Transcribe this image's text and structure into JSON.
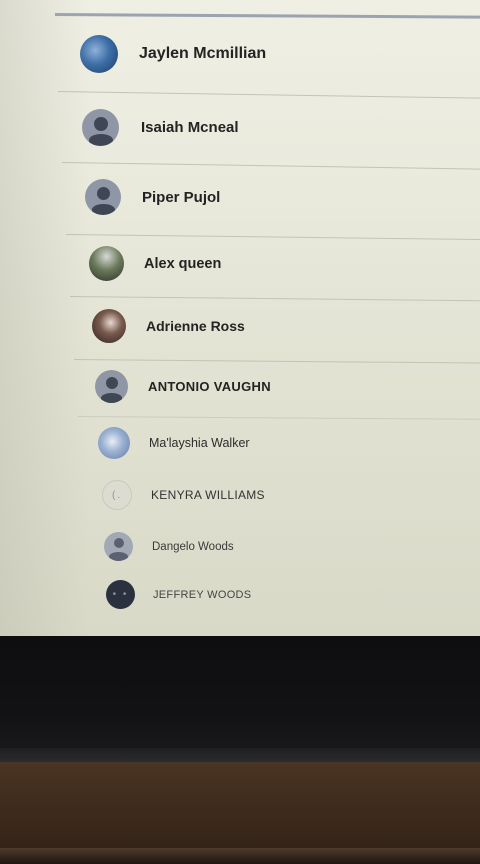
{
  "contacts": [
    {
      "name": "Jaylen Mcmillian",
      "avatar": "photo-blue"
    },
    {
      "name": "Isaiah Mcneal",
      "avatar": "generic-person"
    },
    {
      "name": "Piper Pujol",
      "avatar": "generic-person"
    },
    {
      "name": "Alex queen",
      "avatar": "photo-outdoor"
    },
    {
      "name": "Adrienne Ross",
      "avatar": "photo-person"
    },
    {
      "name": "ANTONIO VAUGHN",
      "avatar": "generic-person"
    },
    {
      "name": "Ma'layshia Walker",
      "avatar": "photo-sky"
    },
    {
      "name": "KENYRA WILLIAMS",
      "avatar": "faint"
    },
    {
      "name": "Dangelo Woods",
      "avatar": "generic-person"
    },
    {
      "name": "JEFFREY WOODS",
      "avatar": "dark"
    }
  ],
  "colors": {
    "screen_background": "#ececdf",
    "divider": "#c3c3b6",
    "generic_avatar_bg": "#8f96a6",
    "generic_avatar_fg": "#3f4654"
  }
}
